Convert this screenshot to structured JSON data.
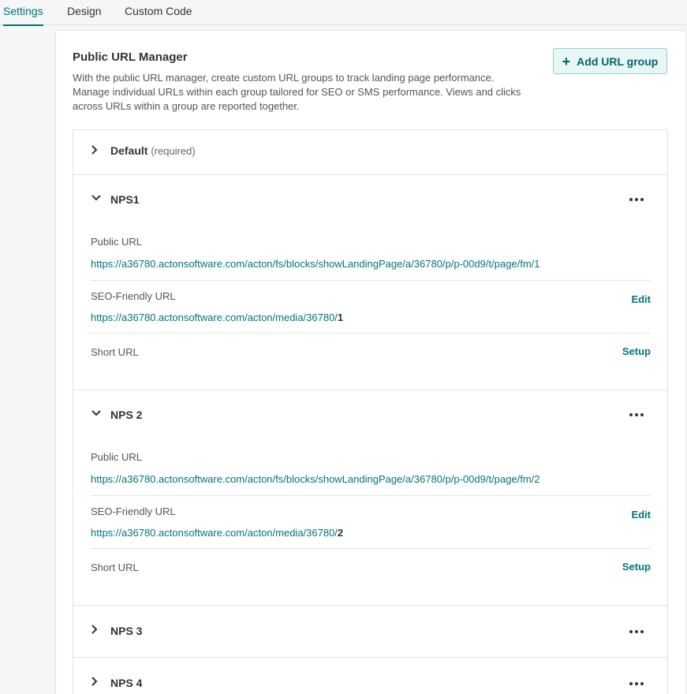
{
  "tabs": [
    {
      "label": "Settings",
      "active": true
    },
    {
      "label": "Design",
      "active": false
    },
    {
      "label": "Custom Code",
      "active": false
    }
  ],
  "panel": {
    "title": "Public URL Manager",
    "description": "With the public URL manager, create custom URL groups to track landing page performance. Manage individual URLs within each group tailored for SEO or SMS performance. Views and clicks across URLs within a group are reported together.",
    "add_button_label": "Add URL group"
  },
  "groups": [
    {
      "name": "Default",
      "suffix": "(required)",
      "expanded": false
    },
    {
      "name": "NPS1",
      "expanded": true,
      "public_url_label": "Public URL",
      "public_url": "https://a36780.actonsoftware.com/acton/fs/blocks/showLandingPage/a/36780/p/p-00d9/t/page/fm/1",
      "seo_label": "SEO-Friendly URL",
      "seo_url_prefix": "https://a36780.actonsoftware.com/acton/media/36780/",
      "seo_url_suffix": "1",
      "seo_action": "Edit",
      "short_label": "Short URL",
      "short_action": "Setup"
    },
    {
      "name": "NPS 2",
      "expanded": true,
      "public_url_label": "Public URL",
      "public_url": "https://a36780.actonsoftware.com/acton/fs/blocks/showLandingPage/a/36780/p/p-00d9/t/page/fm/2",
      "seo_label": "SEO-Friendly URL",
      "seo_url_prefix": "https://a36780.actonsoftware.com/acton/media/36780/",
      "seo_url_suffix": "2",
      "seo_action": "Edit",
      "short_label": "Short URL",
      "short_action": "Setup"
    },
    {
      "name": "NPS 3",
      "expanded": false
    },
    {
      "name": "NPS 4",
      "expanded": false
    }
  ],
  "icons": {
    "collapsed": "chevron-right-icon",
    "expanded": "chevron-down-icon",
    "menu": "more-horizontal-icon",
    "add": "plus-icon"
  },
  "colors": {
    "accent": "#00747a",
    "button_bg": "#e8f6f6",
    "button_border": "#8fd0cf"
  }
}
